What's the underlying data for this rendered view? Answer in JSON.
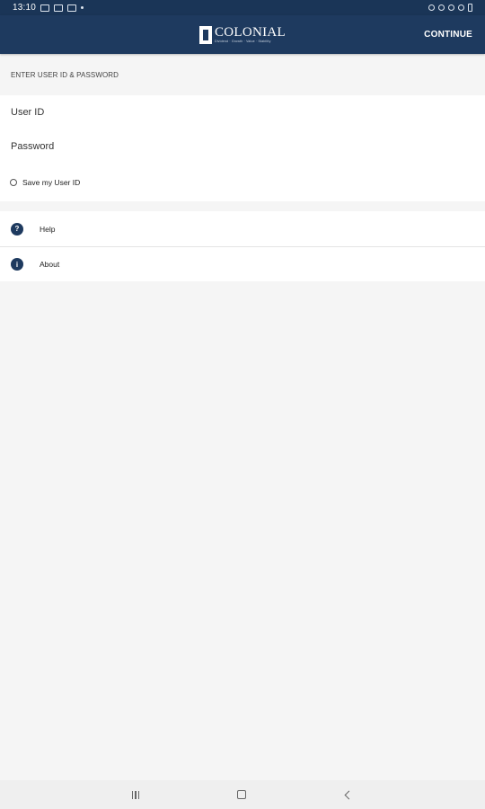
{
  "status_bar": {
    "time": "13:10"
  },
  "app_bar": {
    "logo_text": "COLONIAL",
    "logo_tagline": "Dividend · Growth · Value · Stability",
    "continue_label": "CONTINUE"
  },
  "login": {
    "section_title": "ENTER USER ID & PASSWORD",
    "user_id_placeholder": "User ID",
    "password_placeholder": "Password",
    "save_label": "Save my User ID"
  },
  "menu": {
    "items": [
      {
        "label": "Help",
        "icon": "help-icon",
        "glyph": "?"
      },
      {
        "label": "About",
        "icon": "info-icon",
        "glyph": "i"
      }
    ]
  },
  "colors": {
    "primary": "#1e3a5f",
    "background": "#f5f5f5"
  }
}
